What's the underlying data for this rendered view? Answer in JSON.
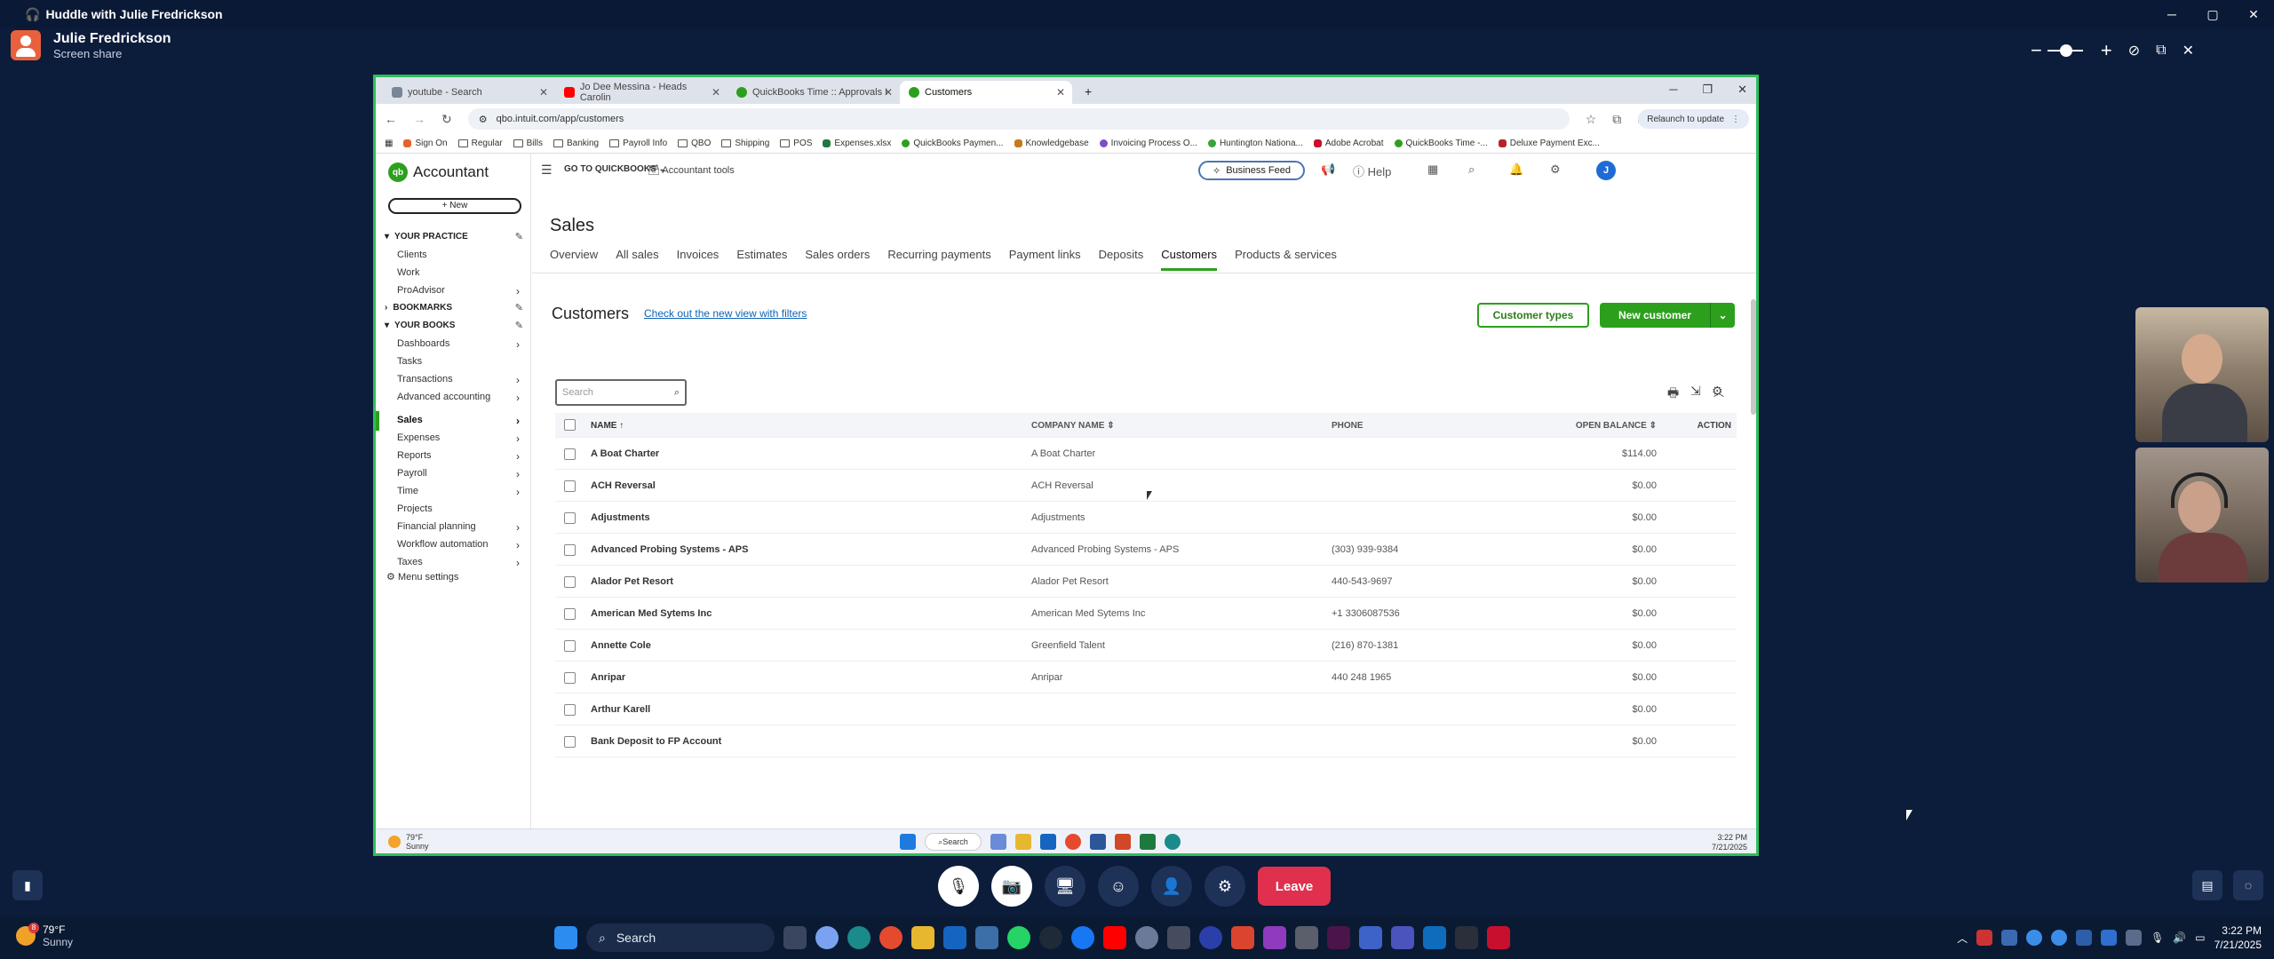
{
  "huddle": {
    "title": "Huddle with Julie Fredrickson",
    "presenter_name": "Julie Fredrickson",
    "presenter_sub": "Screen share",
    "leave_label": "Leave"
  },
  "browser": {
    "tabs": [
      {
        "label": "youtube - Search",
        "color": "#4b5563"
      },
      {
        "label": "Jo Dee Messina - Heads Carolin",
        "color": "#ff0000"
      },
      {
        "label": "QuickBooks Time :: Approvals I",
        "color": "#2ca01c"
      },
      {
        "label": "Customers",
        "color": "#2ca01c"
      }
    ],
    "url": "qbo.intuit.com/app/customers",
    "relaunch": "Relaunch to update",
    "bookmarks": [
      "Sign On",
      "Regular",
      "Bills",
      "Banking",
      "Payroll Info",
      "QBO",
      "Shipping",
      "POS",
      "Expenses.xlsx",
      "QuickBooks Paymen...",
      "Knowledgebase",
      "Invoicing Process O...",
      "Huntington Nationa...",
      "Adobe Acrobat",
      "QuickBooks Time -...",
      "Deluxe Payment Exc..."
    ]
  },
  "qbo": {
    "brand": "Accountant",
    "new_label": "New",
    "goto": "GO TO QUICKBOOKS",
    "accountant_tools": "Accountant tools",
    "business_feed": "Business Feed",
    "help": "Help",
    "user_initial": "J",
    "sidebar": {
      "your_practice": "YOUR PRACTICE",
      "practice_items": [
        "Clients",
        "Work",
        "ProAdvisor"
      ],
      "bookmarks": "BOOKMARKS",
      "your_books": "YOUR BOOKS",
      "book_items": [
        "Dashboards",
        "Tasks",
        "Transactions",
        "Advanced accounting",
        "Sales",
        "Expenses",
        "Reports",
        "Payroll",
        "Time",
        "Projects",
        "Financial planning",
        "Workflow automation",
        "Taxes"
      ],
      "menu_settings": "Menu settings"
    },
    "page_title": "Sales",
    "sales_tabs": [
      "Overview",
      "All sales",
      "Invoices",
      "Estimates",
      "Sales orders",
      "Recurring payments",
      "Payment links",
      "Deposits",
      "Customers",
      "Products & services"
    ],
    "customers_title": "Customers",
    "new_view_link": "Check out the new view with filters",
    "customer_types": "Customer types",
    "new_customer": "New customer",
    "search_placeholder": "Search",
    "table": {
      "headers": {
        "name": "NAME",
        "company": "COMPANY NAME",
        "phone": "PHONE",
        "balance": "OPEN BALANCE",
        "action": "ACTION"
      },
      "rows": [
        {
          "name": "A Boat Charter",
          "company": "A Boat Charter",
          "phone": "",
          "balance": "$114.00"
        },
        {
          "name": "ACH Reversal",
          "company": "ACH Reversal",
          "phone": "",
          "balance": "$0.00"
        },
        {
          "name": "Adjustments",
          "company": "Adjustments",
          "phone": "",
          "balance": "$0.00"
        },
        {
          "name": "Advanced Probing Systems - APS",
          "company": "Advanced Probing Systems - APS",
          "phone": "(303) 939-9384",
          "balance": "$0.00"
        },
        {
          "name": "Alador Pet Resort",
          "company": "Alador Pet Resort",
          "phone": "440-543-9697",
          "balance": "$0.00"
        },
        {
          "name": "American Med Sytems Inc",
          "company": "American Med Sytems Inc",
          "phone": "+1 3306087536",
          "balance": "$0.00"
        },
        {
          "name": "Annette Cole",
          "company": "Greenfield Talent",
          "phone": "(216) 870-1381",
          "balance": "$0.00"
        },
        {
          "name": "Anripar",
          "company": "Anripar",
          "phone": "440 248 1965",
          "balance": "$0.00"
        },
        {
          "name": "Arthur Karell",
          "company": "",
          "phone": "",
          "balance": "$0.00"
        },
        {
          "name": "Bank Deposit to FP Account",
          "company": "",
          "phone": "",
          "balance": "$0.00"
        }
      ]
    }
  },
  "inner_taskbar": {
    "temp": "79°F",
    "cond": "Sunny",
    "search": "Search",
    "time": "3:22 PM",
    "date": "7/21/2025"
  },
  "taskbar": {
    "temp": "79°F",
    "cond": "Sunny",
    "search": "Search",
    "time": "3:22 PM",
    "date": "7/21/2025",
    "badge": "8"
  }
}
